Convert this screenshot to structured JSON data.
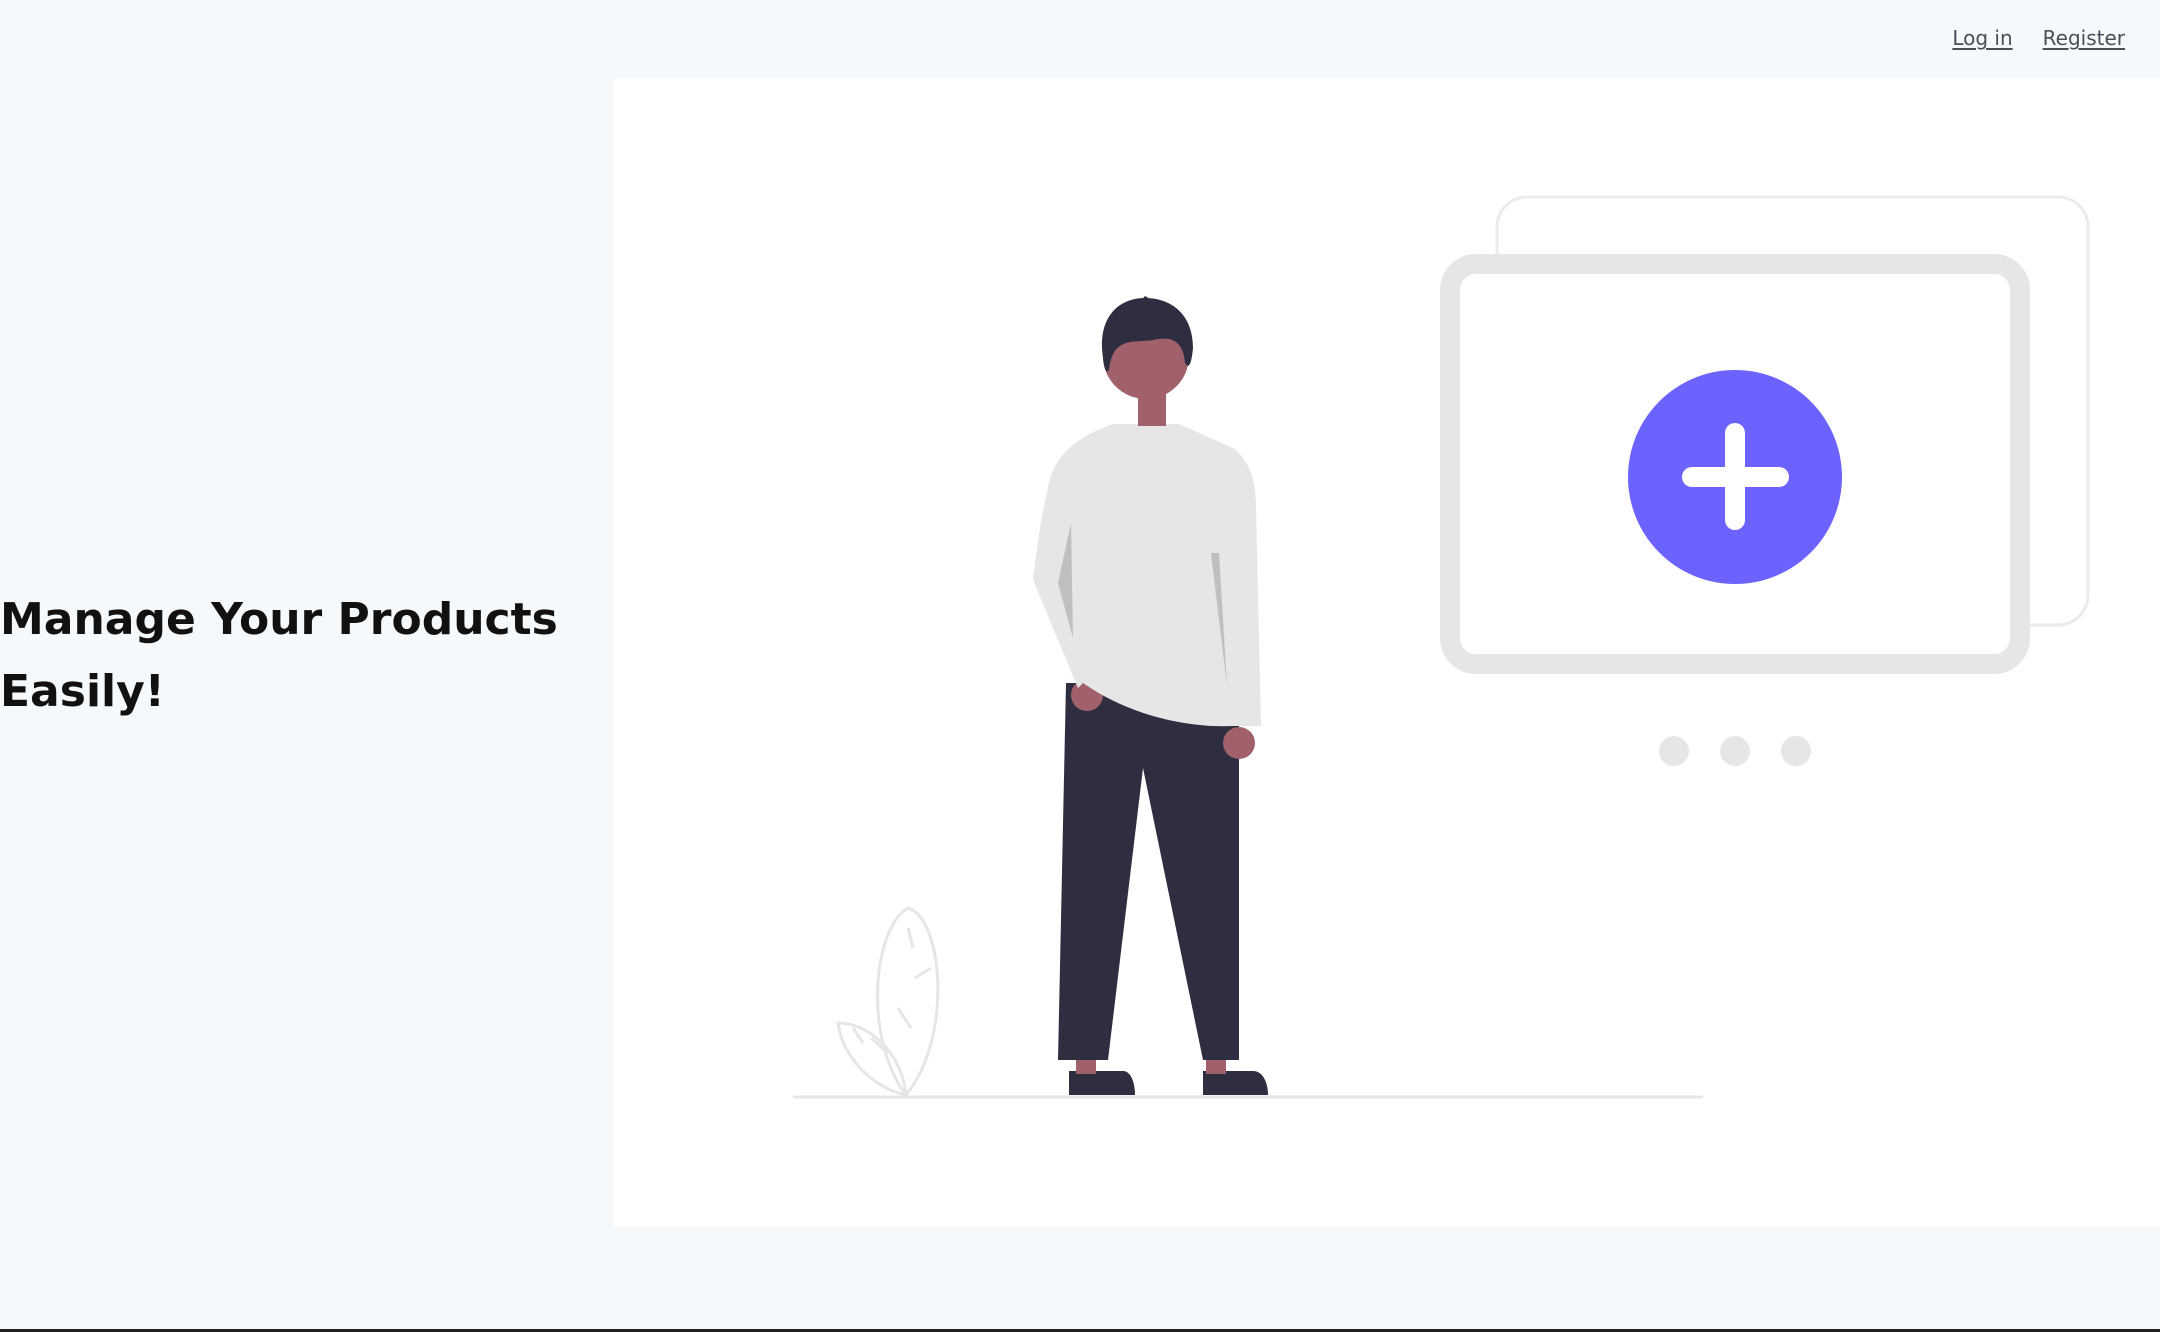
{
  "nav": {
    "login_label": "Log in",
    "register_label": "Register"
  },
  "hero": {
    "title": "Manage Your Products Easily!"
  },
  "illustration": {
    "accent_color": "#6c63ff",
    "skin_color": "#a0616a",
    "dark_color": "#2f2e41",
    "shirt_color": "#e6e6e6",
    "icon_names": [
      "person-icon",
      "plant-icon",
      "add-product-card-icon",
      "plus-icon"
    ]
  }
}
